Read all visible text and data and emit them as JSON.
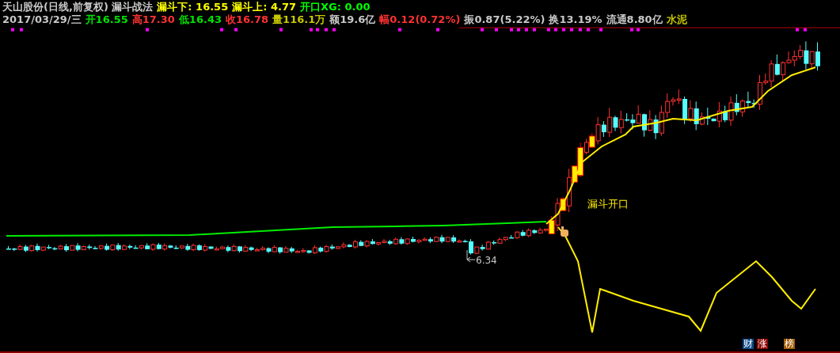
{
  "header": [
    {
      "text": "天山股份(日线,前复权) 漏斗战法",
      "color": "#c8c8c8"
    },
    {
      "text": "漏斗下: 16.55",
      "color": "#ffff00"
    },
    {
      "text": "漏斗上: 4.77",
      "color": "#ffff00"
    },
    {
      "text": "开口XG: 0.00",
      "color": "#00ff00"
    }
  ],
  "quote": [
    {
      "text": "2017/03/29/三",
      "color": "#c8c8c8"
    },
    {
      "text": "开16.55",
      "color": "#00e000"
    },
    {
      "text": "高17.30",
      "color": "#ff3232"
    },
    {
      "text": "低16.43",
      "color": "#00e000"
    },
    {
      "text": "收16.78",
      "color": "#ff3232"
    },
    {
      "text": "量116.1万",
      "color": "#c8c800"
    },
    {
      "text": "额19.6亿",
      "color": "#c8c8c8"
    },
    {
      "text": "幅0.12(0.72%)",
      "color": "#ff3232"
    },
    {
      "text": "振0.87(5.22%)",
      "color": "#c8c8c8"
    },
    {
      "text": "换13.19%",
      "color": "#c8c8c8"
    },
    {
      "text": "流通8.80亿",
      "color": "#c8c8c8"
    },
    {
      "text": "水泥",
      "color": "#c8c800"
    }
  ],
  "chart": {
    "annotation": "漏斗开口",
    "low_label": "6.34"
  },
  "badges": [
    {
      "text": "财",
      "color": "#0f4a8c"
    },
    {
      "text": "涨",
      "color": "#8c0000"
    },
    {
      "text": "榜",
      "color": "#a05a00"
    }
  ]
}
